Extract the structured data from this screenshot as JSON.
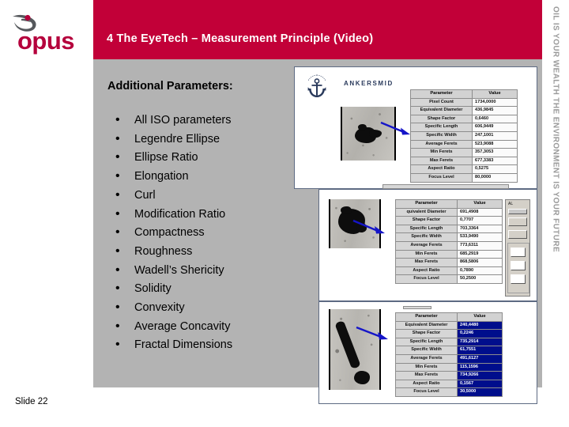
{
  "logo": {
    "word": "opus",
    "mark_name": "opus-swoosh-mark",
    "color": "#b5003c"
  },
  "header": {
    "title": "4  The EyeTech – Measurement Principle (Video)",
    "bar_color": "#c20038"
  },
  "sidebar": {
    "tagline": "OIL IS YOUR WEALTH   THE ENVIRONMENT IS YOUR FUTURE",
    "color": "#9a9a9a"
  },
  "main": {
    "background_color": "#b3b3b3",
    "subtitle": "Additional Parameters:",
    "bullets": [
      "All ISO parameters",
      "Legendre Ellipse",
      "Ellipse Ratio",
      "Elongation",
      "Curl",
      "Modification Ratio",
      "Compactness",
      "Roughness",
      "Wadell’s Shericity",
      "Solidity",
      "Convexity",
      "Average Concavity",
      "Fractal Dimensions"
    ]
  },
  "footer": {
    "slide_number": "Slide 22"
  },
  "panels": [
    {
      "id": "panel-1",
      "brand": "ANKERSMID",
      "brand_logo_name": "ankersmid-anchor-logo",
      "particle_name": "particle-micrograph-irregular",
      "selected": false,
      "table": {
        "headers": [
          "Parameter",
          "Value"
        ],
        "rows": [
          [
            "Pixel Count",
            "1734,0000"
          ],
          [
            "Equivalent Diameter",
            "436,9845"
          ],
          [
            "Shape Factor",
            "0,6460"
          ],
          [
            "Specific Length",
            "606,9449"
          ],
          [
            "Specific Width",
            "247,1001"
          ],
          [
            "Average Ferets",
            "523,9088"
          ],
          [
            "Min Ferets",
            "357,3053"
          ],
          [
            "Max Ferets",
            "677,3383"
          ],
          [
            "Aspect Ratio",
            "0,5275"
          ],
          [
            "Focus Level",
            "80,0000"
          ]
        ]
      }
    },
    {
      "id": "panel-2",
      "brand": "",
      "particle_name": "particle-micrograph-blocky",
      "selected": false,
      "stub_label": "AL",
      "table": {
        "headers": [
          "Parameter",
          "Value"
        ],
        "rows": [
          [
            "quivalent Diameter",
            "691,4908"
          ],
          [
            "Shape Factor",
            "0,7707"
          ],
          [
            "Specific Length",
            "703,3364"
          ],
          [
            "Specific Width",
            "533,9490"
          ],
          [
            "Average Ferets",
            "773,6311"
          ],
          [
            "Min Ferets",
            "685,2919"
          ],
          [
            "Max Ferets",
            "868,5806"
          ],
          [
            "Aspect Ratio",
            "0,7890"
          ],
          [
            "Focus Level",
            "50,2500"
          ]
        ]
      }
    },
    {
      "id": "panel-3",
      "brand": "",
      "particle_name": "particle-micrograph-elongated",
      "selected": true,
      "table": {
        "headers": [
          "Parameter",
          "Value"
        ],
        "rows": [
          [
            "Equivalent Diameter",
            "240,4480"
          ],
          [
            "Shape Factor",
            "0,2246"
          ],
          [
            "Specific Length",
            "735,2914"
          ],
          [
            "Specific Width",
            "61,7551"
          ],
          [
            "Average Ferets",
            "491,6127"
          ],
          [
            "Min Ferets",
            "115,1596"
          ],
          [
            "Max Ferets",
            "734,9266"
          ],
          [
            "Aspect Ratio",
            "0,1567"
          ],
          [
            "Focus Level",
            "30,5000"
          ]
        ]
      }
    }
  ]
}
